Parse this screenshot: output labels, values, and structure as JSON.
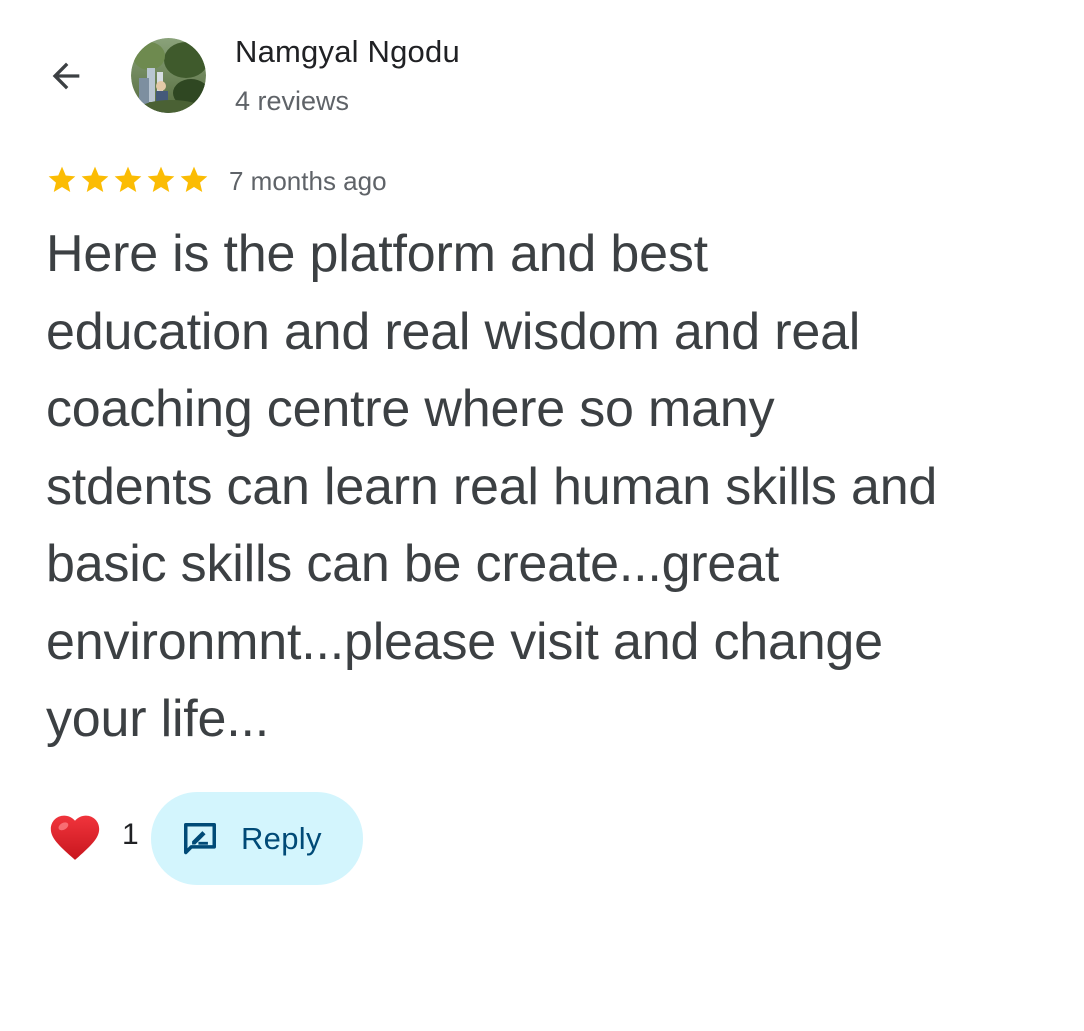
{
  "reviewer": {
    "name": "Namgyal Ngodu",
    "review_count": "4 reviews",
    "avatar_icon": "avatar-photo"
  },
  "review": {
    "rating": 5,
    "rating_max": 5,
    "star_color": "#fbbc04",
    "time": "7 months ago",
    "text": "Here is the platform and best\neducation and real wisdom and real\ncoaching centre where so many\nstdents can learn real human skills and\nbasic skills can be create...great\nenvironmnt...please visit and change\nyour life..."
  },
  "actions": {
    "like_icon": "heart-icon",
    "like_count": "1",
    "reply_icon": "reply-icon",
    "reply_label": "Reply",
    "reply_bg": "#d3f5fd",
    "reply_text_color": "#004a77"
  },
  "nav": {
    "back_icon": "arrow-back-icon"
  }
}
